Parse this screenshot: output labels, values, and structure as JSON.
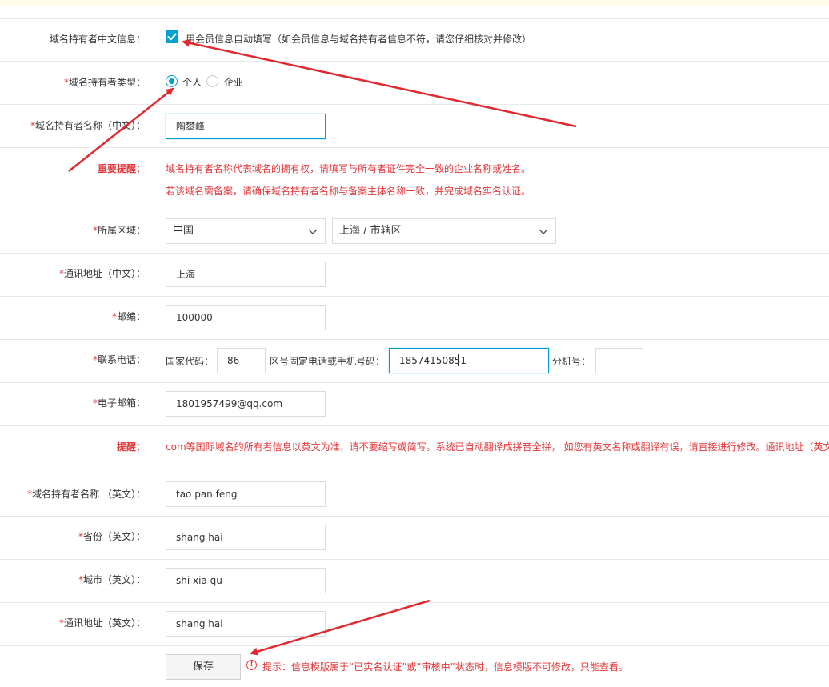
{
  "form": {
    "auto_fill_label": "域名持有者中文信息：",
    "auto_fill_text": "用会员信息自动填写（如会员信息与域名持有者信息不符，请您仔细核对并修改）",
    "auto_fill_checked": true,
    "type_label": "域名持有者类型：",
    "type_options": [
      "个人",
      "企业"
    ],
    "type_selected": "个人",
    "name_cn_label": "域名持有者名称（中文）：",
    "name_cn_value": "陶攀峰",
    "notice_label": "重要提醒：",
    "notice_line1": "域名持有者名称代表域名的拥有权，请填写与所有者证件完全一致的企业名称或姓名。",
    "notice_line2": "若该域名需备案，请确保域名持有者名称与备案主体名称一致，并完成域名实名认证。",
    "region_label": "所属区域：",
    "region_country": "中国",
    "region_city": "上海 / 市辖区",
    "address_cn_label": "通讯地址（中文）：",
    "address_cn_value": "上海",
    "zip_label": "邮编：",
    "zip_value": "100000",
    "phone_label": "联系电话：",
    "phone_country_code_label": "国家代码：",
    "phone_country_code_value": "86",
    "phone_number_label": "区号固定电话或手机号码：",
    "phone_number_value": "18574150851",
    "phone_ext_label": "分机号：",
    "phone_ext_value": "",
    "email_label": "电子邮箱：",
    "email_value": "1801957499@qq.com",
    "tip_label": "提醒：",
    "tip_text": "com等国际域名的所有者信息以英文为准，请不要缩写或简写。系统已自动翻译成拼音全拼， 如您有英文名称或翻译有误，请直接进行修改。通讯地址（英文",
    "name_en_label": "域名持有者名称 （英文）：",
    "name_en_value": "tao pan feng",
    "province_en_label": "省份（英文）：",
    "province_en_value": "shang hai",
    "city_en_label": "城市（英文）：",
    "city_en_value": "shi xia qu",
    "address_en_label": "通讯地址（英文）：",
    "address_en_value": "shang hai",
    "required_mark": "*",
    "save_label": "保存",
    "save_tip": "提示：信息模版属于“已实名认证”或“审核中”状态时，信息模版不可修改，只能查看。"
  },
  "colors": {
    "accent": "#00a0d2",
    "required": "#e4393c",
    "arrow": "#e0282e"
  },
  "icons": {
    "checkbox": "check-icon",
    "select": "chevron-down-icon",
    "tip": "exclamation-circle-icon"
  }
}
